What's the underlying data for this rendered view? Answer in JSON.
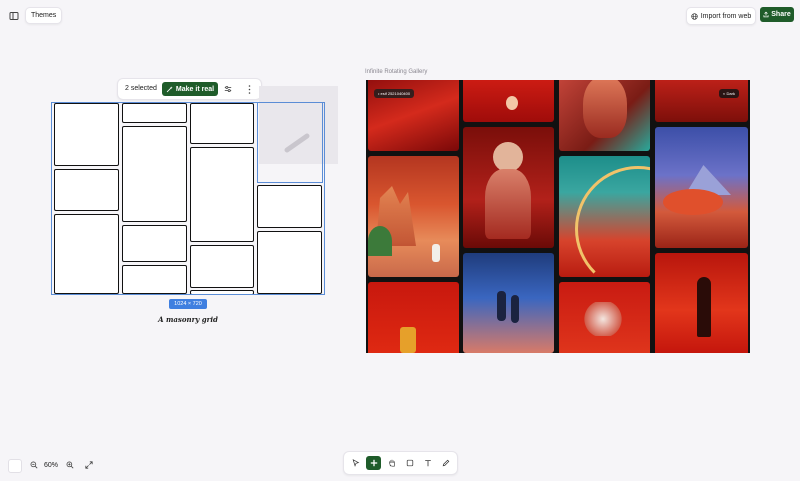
{
  "header": {
    "themes_label": "Themes",
    "import_label": "Import from web",
    "share_label": "Share"
  },
  "selection_toolbar": {
    "count_label": "2 selected",
    "make_real_label": "Make it real"
  },
  "masonry": {
    "dimensions_label": "1024 × 720",
    "caption": "A masonry grid"
  },
  "gallery": {
    "title": "Infinite Rotating Gallery",
    "tag_label": "• esif 2521040400",
    "dark_label": "◐ Dark"
  },
  "zoom": {
    "value": "60%"
  },
  "colors": {
    "accent_green": "#1f5c2a",
    "selection_blue": "#5b8dd6",
    "badge_blue": "#3f7fe0"
  },
  "icons": {
    "sidebar": "sidebar-toggle-icon",
    "import": "globe-icon",
    "share": "share-icon",
    "make_real": "wand-icon",
    "tools": [
      "cursor-icon",
      "plus-icon",
      "hand-icon",
      "square-icon",
      "text-icon",
      "pencil-icon"
    ]
  }
}
